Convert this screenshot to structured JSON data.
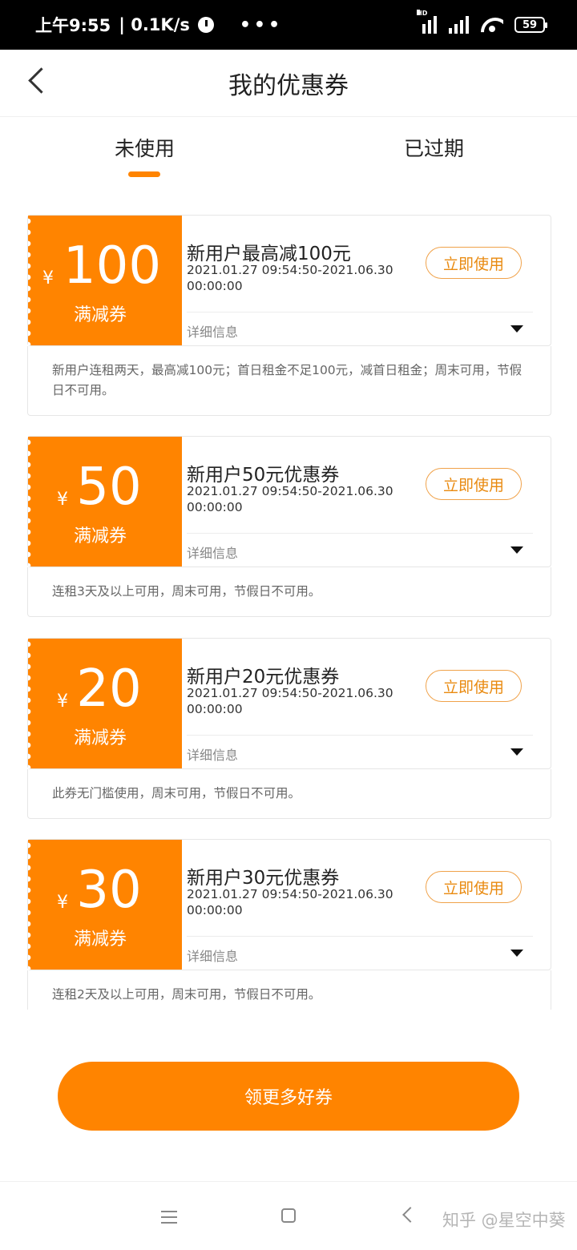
{
  "status_bar": {
    "time": "上午9:55",
    "net_speed": "| 0.1K/s",
    "dots": "•••",
    "hd": "HD",
    "battery": "59"
  },
  "header": {
    "title": "我的优惠券"
  },
  "tabs": [
    {
      "label": "未使用",
      "active": true
    },
    {
      "label": "已过期",
      "active": false
    }
  ],
  "colors": {
    "accent": "#ff8400",
    "button_text": "#e98a10"
  },
  "coupons": [
    {
      "currency": "¥",
      "amount": "100",
      "type": "满减券",
      "title": "新用户最高减100元",
      "date": "2021.01.27 09:54:50-2021.06.30 00:00:00",
      "use_label": "立即使用",
      "detail_label": "详细信息",
      "description": "新用户连租两天，最高减100元；首日租金不足100元，减首日租金；周末可用，节假日不可用。"
    },
    {
      "currency": "¥",
      "amount": "50",
      "type": "满减券",
      "title": "新用户50元优惠券",
      "date": "2021.01.27 09:54:50-2021.06.30 00:00:00",
      "use_label": "立即使用",
      "detail_label": "详细信息",
      "description": "连租3天及以上可用，周末可用，节假日不可用。"
    },
    {
      "currency": "¥",
      "amount": "20",
      "type": "满减券",
      "title": "新用户20元优惠券",
      "date": "2021.01.27 09:54:50-2021.06.30 00:00:00",
      "use_label": "立即使用",
      "detail_label": "详细信息",
      "description": "此券无门槛使用，周末可用，节假日不可用。"
    },
    {
      "currency": "¥",
      "amount": "30",
      "type": "满减券",
      "title": "新用户30元优惠券",
      "date": "2021.01.27 09:54:50-2021.06.30 00:00:00",
      "use_label": "立即使用",
      "detail_label": "详细信息",
      "description": "连租2天及以上可用，周末可用，节假日不可用。"
    }
  ],
  "more_button": {
    "label": "领更多好券"
  },
  "watermark": "知乎 @星空中葵"
}
